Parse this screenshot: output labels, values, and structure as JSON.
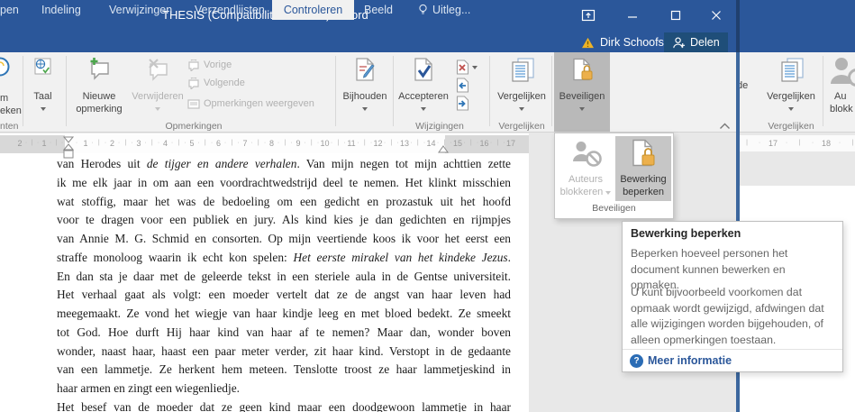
{
  "colors": {
    "accent": "#2b579a",
    "share_bg": "#1f4e79",
    "warning": "#edb327",
    "lock": "#ecb04c",
    "link": "#2b579a"
  },
  "titlebar": {
    "title": "THESIS (Compatibiliteitsmodus) - Word"
  },
  "tabs": {
    "partial_left": "pen",
    "indeling": "Indeling",
    "verwijzingen": "Verwijzingen",
    "verzendlijsten": "Verzendlijsten",
    "controleren": "Controleren",
    "beeld": "Beeld",
    "tellme": "Uitleg...",
    "user": "Dirk Schoofs",
    "share": "Delen"
  },
  "ribbon": {
    "insights": {
      "line1": "m",
      "line2": "eken",
      "group": "nten"
    },
    "language": {
      "label": "Taal"
    },
    "comments": {
      "new1": "Nieuwe",
      "new2": "opmerking",
      "delete": "Verwijderen",
      "previous": "Vorige",
      "next": "Volgende",
      "show": "Opmerkingen weergeven",
      "group": "Opmerkingen"
    },
    "tracking": {
      "label": "Bijhouden"
    },
    "changes": {
      "accept": "Accepteren",
      "group": "Wijzigingen"
    },
    "compare": {
      "label": "Vergelijken",
      "group": "Vergelijken"
    },
    "protect": {
      "label": "Beveiligen"
    }
  },
  "protect_menu": {
    "block1": "Auteurs",
    "block2": "blokkeren",
    "restrict1": "Bewerking",
    "restrict2": "beperken",
    "group": "Beveiligen"
  },
  "tooltip": {
    "title": "Bewerking beperken",
    "p1": "Beperken hoeveel personen het document kunnen bewerken en opmaken.",
    "p2": "U kunt bijvoorbeeld voorkomen dat opmaak wordt gewijzigd, afdwingen dat alle wijzigingen worden bijgehouden, of alleen opmerkingen toestaan.",
    "link": "Meer informatie"
  },
  "ruler": {
    "margin": [
      "2",
      "1"
    ],
    "main": [
      "1",
      "2",
      "3",
      "4",
      "5",
      "6",
      "7",
      "8",
      "9",
      "10",
      "11",
      "12",
      "13",
      "14",
      "15",
      "16",
      "17"
    ]
  },
  "behind": {
    "partial": "de",
    "compare": "Vergelijken",
    "group": "Vergelijken",
    "au1": "Au",
    "au2": "blokk",
    "ruler": [
      "17",
      "18"
    ]
  },
  "document": {
    "lines": [
      {
        "segs": [
          {
            "t": "van Herodes uit "
          },
          {
            "t": "de tijger en andere verhalen",
            "i": true
          },
          {
            "t": ". Van mijn negen tot mijn achttien zette"
          }
        ]
      },
      {
        "segs": [
          {
            "t": "ik me elk jaar in om aan een voordrachtwedstrijd deel te nemen. Het klinkt misschien"
          }
        ]
      },
      {
        "segs": [
          {
            "t": "wat stoffig, maar het was de bedoeling om een gedicht en prozastuk uit het hoofd"
          }
        ]
      },
      {
        "segs": [
          {
            "t": "voor te dragen voor een publiek en jury. Als kind kies je dan gedichten en rijmpjes"
          }
        ]
      },
      {
        "segs": [
          {
            "t": "van Annie M. G. Schmid en consorten. Op mijn veertiende koos ik voor het eerst een"
          }
        ]
      },
      {
        "segs": [
          {
            "t": "straffe monoloog waarin ik echt kon spelen: "
          },
          {
            "t": "Het eerste mirakel van het kindeke Jezus",
            "i": true
          },
          {
            "t": "."
          }
        ]
      },
      {
        "segs": [
          {
            "t": "En dan sta je daar met de geleerde tekst in een steriele aula in de Gentse universiteit."
          }
        ]
      },
      {
        "segs": [
          {
            "t": "Het verhaal gaat als volgt: een moeder vertelt dat ze de angst van haar leven had"
          }
        ]
      },
      {
        "segs": [
          {
            "t": "meegemaakt. Ze vond het wiegje van haar kindje leeg en met bloed bedekt. Ze smeekt"
          }
        ]
      },
      {
        "segs": [
          {
            "t": "tot God. Hoe durft Hij haar kind van haar af te nemen? Maar dan, wonder boven"
          }
        ]
      },
      {
        "segs": [
          {
            "t": "wonder, naast haar, haast een paar meter verder, zit haar kind. Verstopt in de gedaante"
          }
        ]
      },
      {
        "segs": [
          {
            "t": "van een lammetje. Ze herkent hem meteen. Tenslotte troost ze haar lammetjeskind in"
          }
        ]
      },
      {
        "segs": [
          {
            "t": "haar armen en zingt een wiegenliedje."
          }
        ],
        "j": false
      },
      {
        "segs": [
          {
            "t": "Het besef van de moeder dat ze geen kind maar een doodgewoon lammetje in haar"
          }
        ]
      }
    ]
  }
}
